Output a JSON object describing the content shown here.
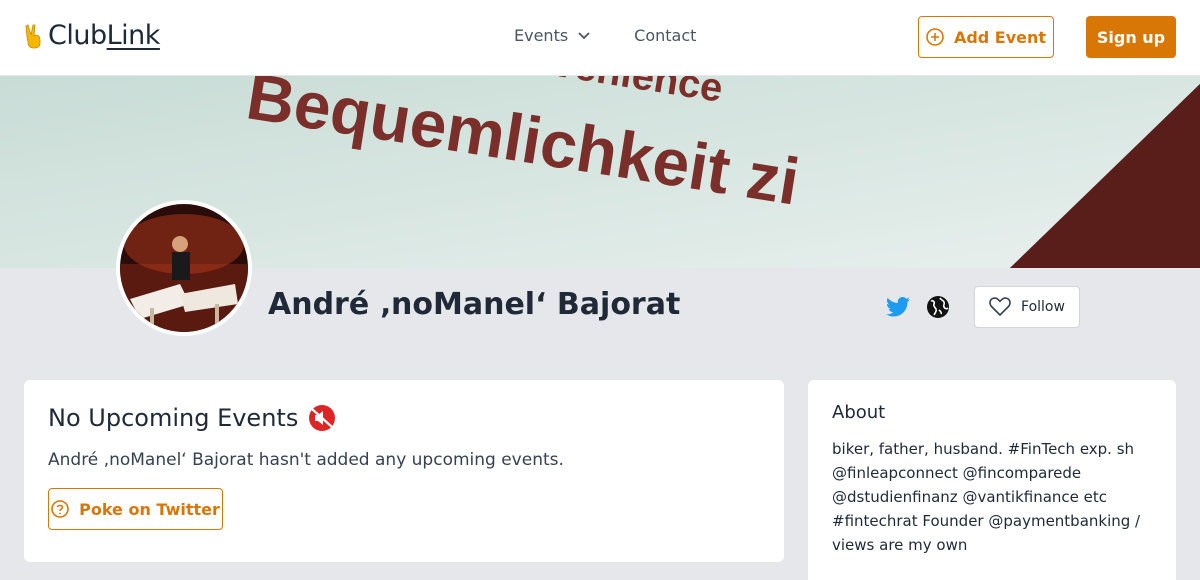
{
  "header": {
    "logo_prefix": "Club",
    "logo_suffix": "Link",
    "nav": {
      "events_label": "Events",
      "contact_label": "Contact"
    },
    "add_event_label": "Add Event",
    "signup_label": "Sign up"
  },
  "banner": {
    "line1": "macht Convenience",
    "line2": "Bequemlichkeit zi"
  },
  "profile": {
    "name": "André ‚noManel‘ Bajorat",
    "follow_label": "Follow"
  },
  "events_card": {
    "title": "No Upcoming Events",
    "message": "André ‚noManel‘ Bajorat hasn't added any upcoming events.",
    "poke_label": "Poke on Twitter"
  },
  "about_card": {
    "title": "About",
    "bio": "biker, father, husband. #FinTech exp. sh @finleapconnect @fincomparede @dstudienfinanz @vantikfinance etc #fintechrat Founder @paymentbanking / views are my own"
  },
  "colors": {
    "accent": "#d97706",
    "twitter": "#1d9bf0",
    "page_bg": "#e5e7eb"
  },
  "icons": [
    "victory-hand-icon",
    "chevron-down-icon",
    "plus-circle-icon",
    "twitter-icon",
    "globe-icon",
    "heart-icon",
    "muted-speaker-icon",
    "question-circle-icon"
  ]
}
